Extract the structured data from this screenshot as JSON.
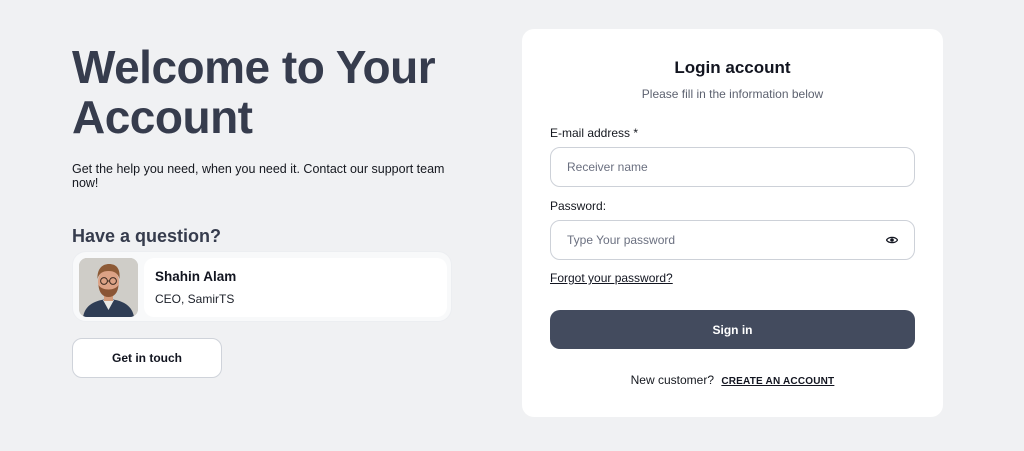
{
  "hero": {
    "title_line1": "Welcome to Your",
    "title_line2": "Account",
    "subtitle": "Get the help you need, when you need it. Contact our support team now!",
    "question": "Have a question?"
  },
  "contact": {
    "name": "Shahin Alam",
    "role": "CEO, SamirTS",
    "button_label": "Get in touch"
  },
  "login": {
    "title": "Login account",
    "subtitle": "Please fill in the information below",
    "email_label": "E-mail address *",
    "email_placeholder": "Receiver name",
    "email_value": "",
    "password_label": "Password:",
    "password_placeholder": "Type Your password",
    "password_value": "",
    "forgot_label": "Forgot your password?",
    "signin_label": "Sign in",
    "new_customer_text": "New customer?",
    "create_account_label": "CREATE AN ACCOUNT"
  },
  "icons": {
    "password_toggle": "eye-icon",
    "avatar": "person-photo"
  },
  "colors": {
    "page_background": "#f0f1f3",
    "heading": "#363c4d",
    "primary_button": "#434b5e",
    "card_background": "#ffffff"
  }
}
